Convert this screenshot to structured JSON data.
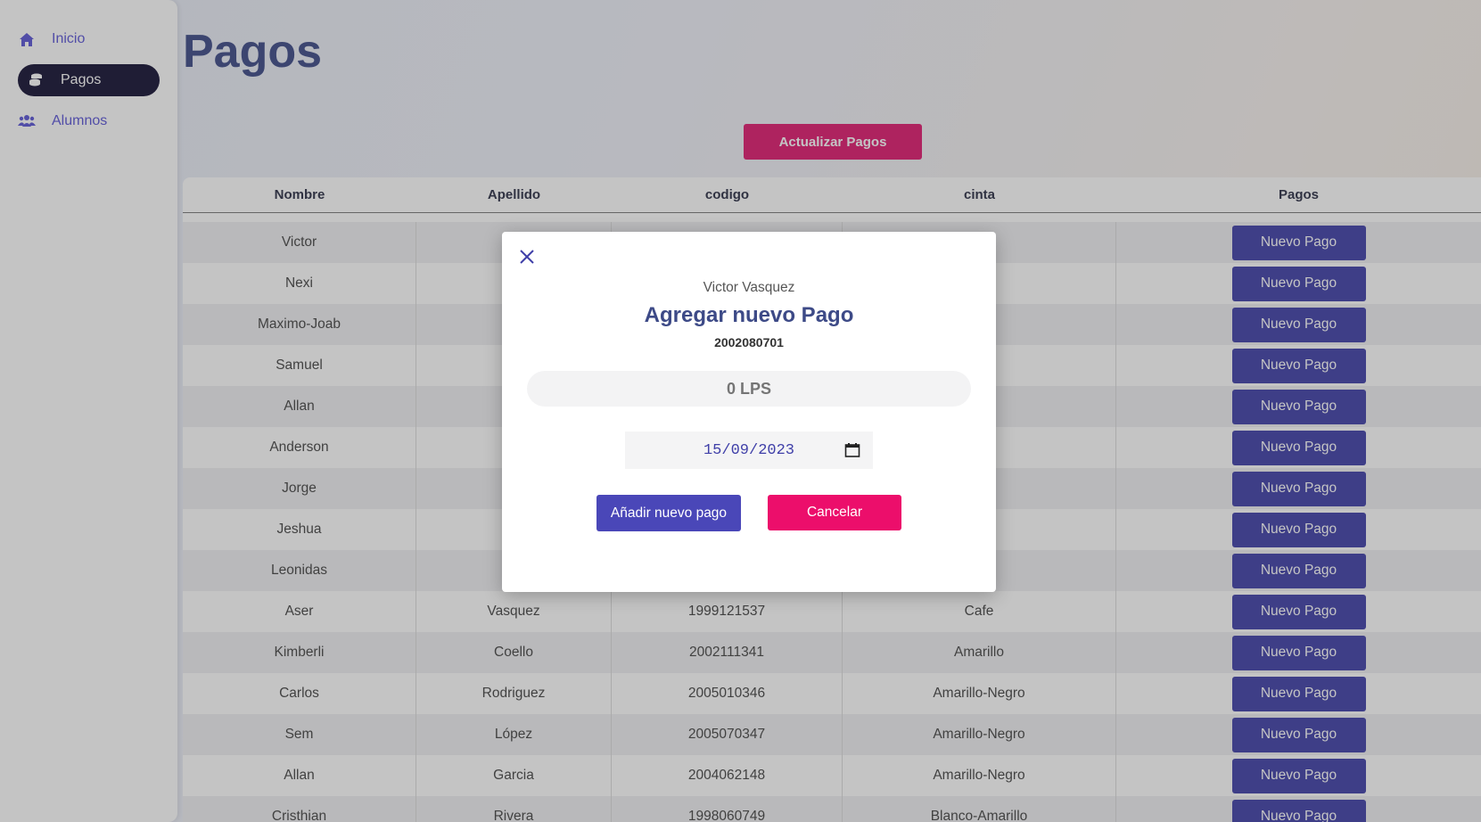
{
  "sidebar": {
    "items": [
      {
        "label": "Inicio",
        "icon": "home-icon"
      },
      {
        "label": "Pagos",
        "icon": "coins-icon",
        "active": true
      },
      {
        "label": "Alumnos",
        "icon": "users-icon"
      }
    ]
  },
  "page": {
    "title": "Pagos",
    "refresh_label": "Actualizar Pagos"
  },
  "table": {
    "headers": [
      "Nombre",
      "Apellido",
      "codigo",
      "cinta",
      "Pagos"
    ],
    "pay_label": "Nuevo Pago",
    "rows": [
      {
        "nombre": "Victor",
        "apellido": "Va",
        "codigo": "",
        "cinta": "o"
      },
      {
        "nombre": "Nexi",
        "apellido": "Va",
        "codigo": "",
        "cinta": ""
      },
      {
        "nombre": "Maximo-Joab",
        "apellido": "Va",
        "codigo": "",
        "cinta": "o"
      },
      {
        "nombre": "Samuel",
        "apellido": "Va",
        "codigo": "",
        "cinta": "o"
      },
      {
        "nombre": "Allan",
        "apellido": "R",
        "codigo": "",
        "cinta": "ojo"
      },
      {
        "nombre": "Anderson",
        "apellido": "H",
        "codigo": "",
        "cinta": ""
      },
      {
        "nombre": "Jorge",
        "apellido": "S",
        "codigo": "",
        "cinta": "ojo"
      },
      {
        "nombre": "Jeshua",
        "apellido": "",
        "codigo": "",
        "cinta": ""
      },
      {
        "nombre": "Leonidas",
        "apellido": "G",
        "codigo": "",
        "cinta": "ojo"
      },
      {
        "nombre": "Aser",
        "apellido": "Vasquez",
        "codigo": "1999121537",
        "cinta": "Cafe"
      },
      {
        "nombre": "Kimberli",
        "apellido": "Coello",
        "codigo": "2002111341",
        "cinta": "Amarillo"
      },
      {
        "nombre": "Carlos",
        "apellido": "Rodriguez",
        "codigo": "2005010346",
        "cinta": "Amarillo-Negro"
      },
      {
        "nombre": "Sem",
        "apellido": "López",
        "codigo": "2005070347",
        "cinta": "Amarillo-Negro"
      },
      {
        "nombre": "Allan",
        "apellido": "Garcia",
        "codigo": "2004062148",
        "cinta": "Amarillo-Negro"
      },
      {
        "nombre": "Cristhian",
        "apellido": "Rivera",
        "codigo": "1998060749",
        "cinta": "Blanco-Amarillo"
      }
    ]
  },
  "modal": {
    "student": "Victor Vasquez",
    "title": "Agregar nuevo Pago",
    "code": "2002080701",
    "amount_placeholder": "0 LPS",
    "date_value": "15/09/2023",
    "add_label": "Añadir nuevo pago",
    "cancel_label": "Cancelar"
  },
  "colors": {
    "accent": "#3f3fa8",
    "danger": "#ec0e6b",
    "sidebar_active": "#141033",
    "title": "#3d4a87"
  }
}
